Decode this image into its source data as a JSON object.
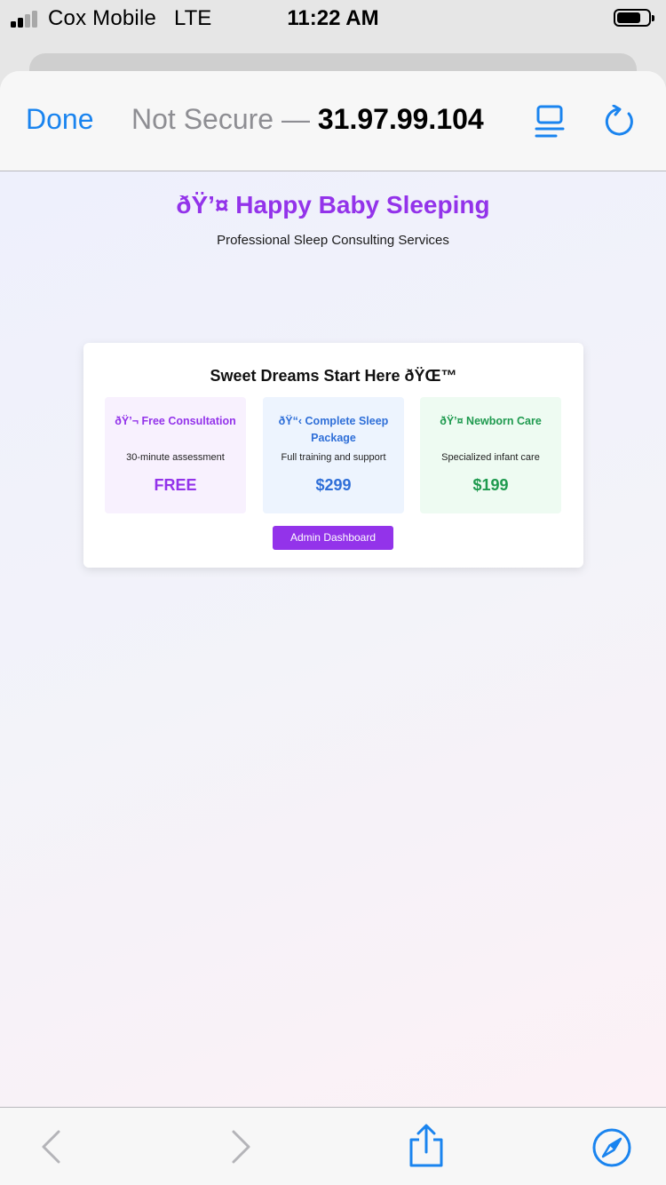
{
  "status_bar": {
    "carrier": "Cox Mobile",
    "network": "LTE",
    "time": "11:22 AM",
    "signal_bars_active": 2,
    "signal_bars_total": 4,
    "icons": [
      "signal-icon",
      "battery-icon"
    ]
  },
  "browser": {
    "done_label": "Done",
    "security_label": "Not Secure —",
    "host": "31.97.99.104",
    "accent_color": "#1a84ef",
    "icons": [
      "reader-icon",
      "reload-icon",
      "back-icon",
      "forward-icon",
      "share-icon",
      "compass-icon"
    ]
  },
  "page": {
    "title": "ðŸ’¤ Happy Baby Sleeping",
    "subtitle": "Professional Sleep Consulting Services",
    "brand_color": "#9333ea",
    "card": {
      "title": "Sweet Dreams Start Here ðŸŒ™",
      "services": [
        {
          "name": "ðŸ’¬ Free Consultation",
          "description": "30-minute assessment",
          "price": "FREE",
          "color": "#9333ea"
        },
        {
          "name": "ðŸ“‹ Complete Sleep Package",
          "description": "Full training and support",
          "price": "$299",
          "color": "#2f6fd8"
        },
        {
          "name": "ðŸ’¤ Newborn Care",
          "description": "Specialized infant care",
          "price": "$199",
          "color": "#1f9a4f"
        }
      ],
      "admin_button_label": "Admin Dashboard"
    }
  }
}
